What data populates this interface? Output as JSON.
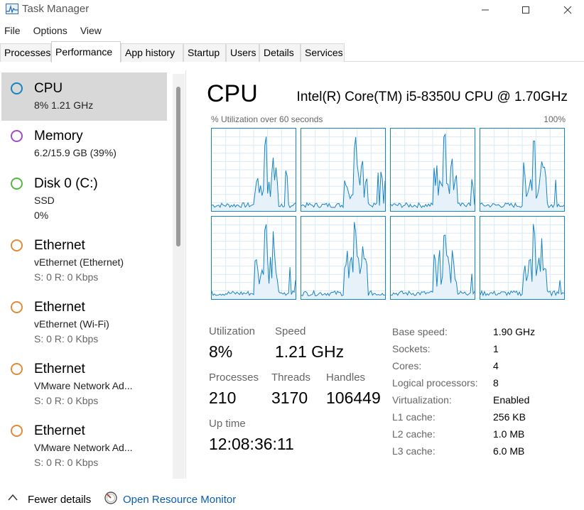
{
  "window": {
    "title": "Task Manager",
    "icons": {
      "app": "task-manager-icon",
      "minimize": "minimize-icon",
      "maximize": "maximize-icon",
      "close": "close-icon"
    }
  },
  "menu": [
    "File",
    "Options",
    "View"
  ],
  "tabs": [
    {
      "label": "Processes",
      "active": false
    },
    {
      "label": "Performance",
      "active": true
    },
    {
      "label": "App history",
      "active": false
    },
    {
      "label": "Startup",
      "active": false
    },
    {
      "label": "Users",
      "active": false
    },
    {
      "label": "Details",
      "active": false
    },
    {
      "label": "Services",
      "active": false
    }
  ],
  "sidebar": {
    "items": [
      {
        "title": "CPU",
        "sub1": "8% 1.21 GHz",
        "sub2": "",
        "color": "#1784c2",
        "selected": true
      },
      {
        "title": "Memory",
        "sub1": "6.2/15.9 GB (39%)",
        "sub2": "",
        "color": "#a64bc5",
        "selected": false
      },
      {
        "title": "Disk 0 (C:)",
        "sub1": "SSD",
        "sub2": "0%",
        "color": "#58b545",
        "selected": false
      },
      {
        "title": "Ethernet",
        "sub1": "vEthernet (Ethernet)",
        "sub2": "S: 0 R: 0 Kbps",
        "color": "#d07a33",
        "selected": false
      },
      {
        "title": "Ethernet",
        "sub1": "vEthernet (Wi-Fi)",
        "sub2": "S: 0 R: 0 Kbps",
        "color": "#d07a33",
        "selected": false
      },
      {
        "title": "Ethernet",
        "sub1": "VMware Network Ad...",
        "sub2": "S: 0 R: 0 Kbps",
        "color": "#d07a33",
        "selected": false
      },
      {
        "title": "Ethernet",
        "sub1": "VMware Network Ad...",
        "sub2": "S: 0 R: 0 Kbps",
        "color": "#d07a33",
        "selected": false
      }
    ]
  },
  "main": {
    "heading": "CPU",
    "model": "Intel(R) Core(TM) i5-8350U CPU @ 1.70GHz",
    "graph_caption": "% Utilization over 60 seconds",
    "graph_max": "100%",
    "graph_color": "#1784c2",
    "stats": {
      "utilization_label": "Utilization",
      "utilization": "8%",
      "speed_label": "Speed",
      "speed": "1.21 GHz",
      "processes_label": "Processes",
      "processes": "210",
      "threads_label": "Threads",
      "threads": "3170",
      "handles_label": "Handles",
      "handles": "106449",
      "uptime_label": "Up time",
      "uptime": "12:08:36:11"
    },
    "info": [
      {
        "label": "Base speed:",
        "value": "1.90 GHz"
      },
      {
        "label": "Sockets:",
        "value": "1"
      },
      {
        "label": "Cores:",
        "value": "4"
      },
      {
        "label": "Logical processors:",
        "value": "8"
      },
      {
        "label": "Virtualization:",
        "value": "Enabled"
      },
      {
        "label": "L1 cache:",
        "value": "256 KB"
      },
      {
        "label": "L2 cache:",
        "value": "1.0 MB"
      },
      {
        "label": "L3 cache:",
        "value": "6.0 MB"
      }
    ]
  },
  "footer": {
    "fewer_details": "Fewer details",
    "fewer_icon": "chevron-up-icon",
    "open_monitor": "Open Resource Monitor",
    "monitor_icon": "resource-monitor-icon"
  }
}
